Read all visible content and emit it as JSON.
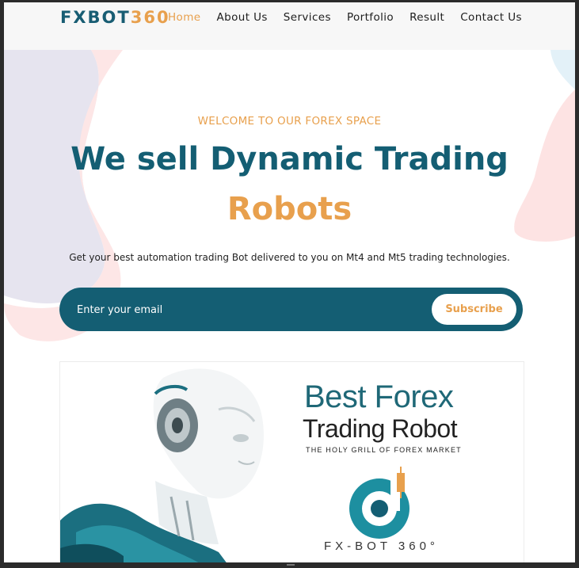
{
  "brand": {
    "logo_part1": "FXBOT",
    "logo_part2": "360"
  },
  "nav": {
    "items": [
      {
        "label": "Home",
        "active": true
      },
      {
        "label": "About Us",
        "active": false
      },
      {
        "label": "Services",
        "active": false
      },
      {
        "label": "Portfolio",
        "active": false
      },
      {
        "label": "Result",
        "active": false
      },
      {
        "label": "Contact Us",
        "active": false
      }
    ]
  },
  "hero": {
    "eyebrow": "WELCOME TO OUR FOREX SPACE",
    "title_line1": "We sell Dynamic Trading",
    "title_line2": "Robots",
    "subtitle": "Get your best automation trading Bot delivered to you on Mt4 and Mt5 trading technologies."
  },
  "subscribe": {
    "email_placeholder": "Enter your email",
    "button_label": "Subscribe"
  },
  "banner": {
    "title_line1": "Best Forex",
    "title_line2": "Trading Robot",
    "tagline": "THE HOLY GRILL OF FOREX MARKET",
    "brand_text": "FX-BOT 360°"
  },
  "colors": {
    "primary": "#145e73",
    "accent": "#e8a04d",
    "nav_bg": "#f7f7f7"
  }
}
